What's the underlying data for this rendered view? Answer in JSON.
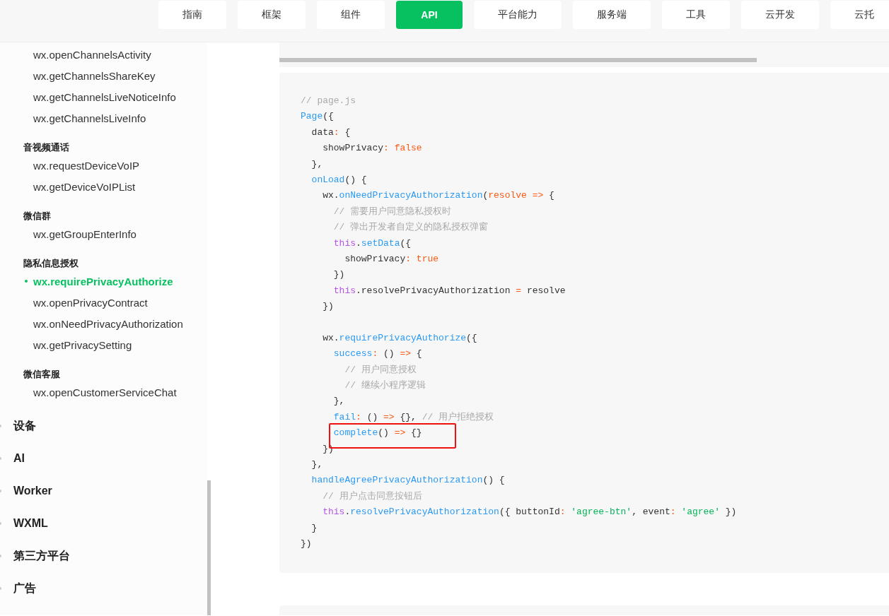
{
  "nav_tabs": [
    {
      "label": "指南",
      "selected": false
    },
    {
      "label": "框架",
      "selected": false
    },
    {
      "label": "组件",
      "selected": false
    },
    {
      "label": "API",
      "selected": true
    },
    {
      "label": "平台能力",
      "selected": false
    },
    {
      "label": "服务端",
      "selected": false
    },
    {
      "label": "工具",
      "selected": false
    },
    {
      "label": "云开发",
      "selected": false
    },
    {
      "label": "云托",
      "selected": false
    }
  ],
  "sidebar": {
    "sections": [
      {
        "items": [
          {
            "label": "wx.openChannelsActivity",
            "selected": false
          },
          {
            "label": "wx.getChannelsShareKey",
            "selected": false
          },
          {
            "label": "wx.getChannelsLiveNoticeInfo",
            "selected": false
          },
          {
            "label": "wx.getChannelsLiveInfo",
            "selected": false
          }
        ]
      },
      {
        "heading": "音视频通话",
        "items": [
          {
            "label": "wx.requestDeviceVoIP",
            "selected": false
          },
          {
            "label": "wx.getDeviceVoIPList",
            "selected": false
          }
        ]
      },
      {
        "heading": "微信群",
        "items": [
          {
            "label": "wx.getGroupEnterInfo",
            "selected": false
          }
        ]
      },
      {
        "heading": "隐私信息授权",
        "items": [
          {
            "label": "wx.requirePrivacyAuthorize",
            "selected": true
          },
          {
            "label": "wx.openPrivacyContract",
            "selected": false
          },
          {
            "label": "wx.onNeedPrivacyAuthorization",
            "selected": false
          },
          {
            "label": "wx.getPrivacySetting",
            "selected": false
          }
        ]
      },
      {
        "heading": "微信客服",
        "items": [
          {
            "label": "wx.openCustomerServiceChat",
            "selected": false
          }
        ]
      }
    ],
    "categories": [
      {
        "label": "设备"
      },
      {
        "label": "AI"
      },
      {
        "label": "Worker"
      },
      {
        "label": "WXML"
      },
      {
        "label": "第三方平台"
      },
      {
        "label": "广告"
      }
    ]
  },
  "code_block": {
    "lines": [
      {
        "kind": "code",
        "highlighted": false,
        "tokens": [
          {
            "kind": "comment",
            "text": "// page.js"
          }
        ]
      },
      {
        "kind": "code",
        "highlighted": false,
        "tokens": [
          {
            "kind": "func",
            "text": "Page"
          },
          {
            "kind": "plain",
            "text": "({"
          }
        ]
      },
      {
        "kind": "code",
        "highlighted": false,
        "tokens": [
          {
            "kind": "plain",
            "text": "  data"
          },
          {
            "kind": "op",
            "text": ":"
          },
          {
            "kind": "plain",
            "text": " {"
          }
        ]
      },
      {
        "kind": "code",
        "highlighted": false,
        "tokens": [
          {
            "kind": "plain",
            "text": "    showPrivacy"
          },
          {
            "kind": "op",
            "text": ": false"
          }
        ]
      },
      {
        "kind": "code",
        "highlighted": false,
        "tokens": [
          {
            "kind": "plain",
            "text": "  },"
          }
        ]
      },
      {
        "kind": "code",
        "highlighted": false,
        "tokens": [
          {
            "kind": "func",
            "text": "  onLoad"
          },
          {
            "kind": "plain",
            "text": "() {"
          }
        ]
      },
      {
        "kind": "code",
        "highlighted": false,
        "tokens": [
          {
            "kind": "plain",
            "text": "    wx."
          },
          {
            "kind": "func",
            "text": "onNeedPrivacyAuthorization"
          },
          {
            "kind": "plain",
            "text": "("
          },
          {
            "kind": "op",
            "text": "resolve =>"
          },
          {
            "kind": "plain",
            "text": " {"
          }
        ]
      },
      {
        "kind": "code",
        "highlighted": false,
        "tokens": [
          {
            "kind": "comment",
            "text": "      // 需要用户同意隐私授权时"
          }
        ]
      },
      {
        "kind": "code",
        "highlighted": false,
        "tokens": [
          {
            "kind": "comment",
            "text": "      // 弹出开发者自定义的隐私授权弹窗"
          }
        ]
      },
      {
        "kind": "code",
        "highlighted": false,
        "tokens": [
          {
            "kind": "keyword",
            "text": "      this"
          },
          {
            "kind": "plain",
            "text": "."
          },
          {
            "kind": "func",
            "text": "setData"
          },
          {
            "kind": "plain",
            "text": "({"
          }
        ]
      },
      {
        "kind": "code",
        "highlighted": false,
        "tokens": [
          {
            "kind": "plain",
            "text": "        showPrivacy"
          },
          {
            "kind": "op",
            "text": ": true"
          }
        ]
      },
      {
        "kind": "code",
        "highlighted": false,
        "tokens": [
          {
            "kind": "plain",
            "text": "      })"
          }
        ]
      },
      {
        "kind": "code",
        "highlighted": false,
        "tokens": [
          {
            "kind": "keyword",
            "text": "      this"
          },
          {
            "kind": "plain",
            "text": ".resolvePrivacyAuthorization "
          },
          {
            "kind": "op",
            "text": "="
          },
          {
            "kind": "plain",
            "text": " resolve"
          }
        ]
      },
      {
        "kind": "code",
        "highlighted": false,
        "tokens": [
          {
            "kind": "plain",
            "text": "    })"
          }
        ]
      },
      {
        "kind": "blank"
      },
      {
        "kind": "code",
        "highlighted": false,
        "tokens": [
          {
            "kind": "plain",
            "text": "    wx."
          },
          {
            "kind": "func",
            "text": "requirePrivacyAuthorize"
          },
          {
            "kind": "plain",
            "text": "({"
          }
        ]
      },
      {
        "kind": "code",
        "highlighted": false,
        "tokens": [
          {
            "kind": "func",
            "text": "      success"
          },
          {
            "kind": "op",
            "text": ":"
          },
          {
            "kind": "plain",
            "text": " () "
          },
          {
            "kind": "op",
            "text": "=>"
          },
          {
            "kind": "plain",
            "text": " {"
          }
        ]
      },
      {
        "kind": "code",
        "highlighted": false,
        "tokens": [
          {
            "kind": "comment",
            "text": "        // 用户同意授权"
          }
        ]
      },
      {
        "kind": "code",
        "highlighted": false,
        "tokens": [
          {
            "kind": "comment",
            "text": "        // 继续小程序逻辑"
          }
        ]
      },
      {
        "kind": "code",
        "highlighted": false,
        "tokens": [
          {
            "kind": "plain",
            "text": "      },"
          }
        ]
      },
      {
        "kind": "code",
        "highlighted": false,
        "tokens": [
          {
            "kind": "func",
            "text": "      fail"
          },
          {
            "kind": "op",
            "text": ":"
          },
          {
            "kind": "plain",
            "text": " () "
          },
          {
            "kind": "op",
            "text": "=>"
          },
          {
            "kind": "plain",
            "text": " {}, "
          },
          {
            "kind": "comment",
            "text": "// 用户拒绝授权"
          }
        ]
      },
      {
        "kind": "code",
        "highlighted": true,
        "tokens": [
          {
            "kind": "func",
            "text": "      complete"
          },
          {
            "kind": "plain",
            "text": "() "
          },
          {
            "kind": "op",
            "text": "=>"
          },
          {
            "kind": "plain",
            "text": " {}"
          }
        ]
      },
      {
        "kind": "code",
        "highlighted": false,
        "tokens": [
          {
            "kind": "plain",
            "text": "    })"
          }
        ]
      },
      {
        "kind": "code",
        "highlighted": false,
        "tokens": [
          {
            "kind": "plain",
            "text": "  },"
          }
        ]
      },
      {
        "kind": "code",
        "highlighted": false,
        "tokens": [
          {
            "kind": "func",
            "text": "  handleAgreePrivacyAuthorization"
          },
          {
            "kind": "plain",
            "text": "() {"
          }
        ]
      },
      {
        "kind": "code",
        "highlighted": false,
        "tokens": [
          {
            "kind": "comment",
            "text": "    // 用户点击同意按钮后"
          }
        ]
      },
      {
        "kind": "code",
        "highlighted": false,
        "tokens": [
          {
            "kind": "keyword",
            "text": "    this"
          },
          {
            "kind": "plain",
            "text": "."
          },
          {
            "kind": "func",
            "text": "resolvePrivacyAuthorization"
          },
          {
            "kind": "plain",
            "text": "({ buttonId"
          },
          {
            "kind": "op",
            "text": ":"
          },
          {
            "kind": "string",
            "text": " 'agree-btn'"
          },
          {
            "kind": "plain",
            "text": ", event"
          },
          {
            "kind": "op",
            "text": ":"
          },
          {
            "kind": "string",
            "text": " 'agree'"
          },
          {
            "kind": "plain",
            "text": " })"
          }
        ]
      },
      {
        "kind": "code",
        "highlighted": false,
        "tokens": [
          {
            "kind": "plain",
            "text": "  }"
          }
        ]
      },
      {
        "kind": "code",
        "highlighted": false,
        "tokens": [
          {
            "kind": "plain",
            "text": "})"
          }
        ]
      }
    ]
  }
}
